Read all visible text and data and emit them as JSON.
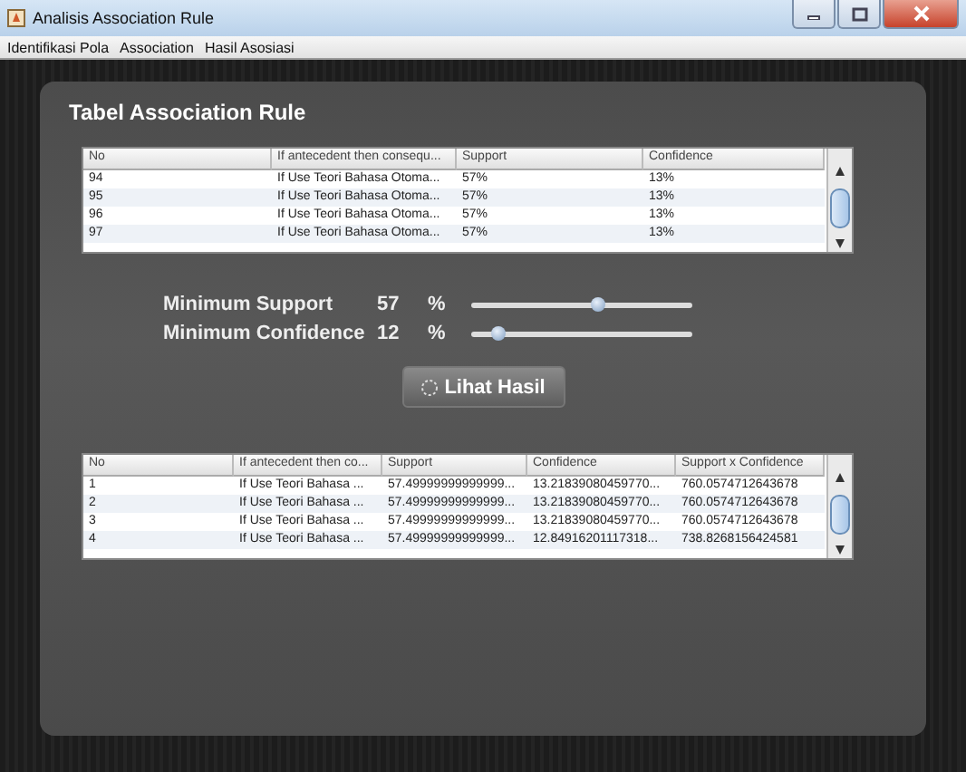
{
  "window": {
    "title": "Analisis Association Rule"
  },
  "menu": [
    {
      "label": "Identifikasi Pola"
    },
    {
      "label": "Association"
    },
    {
      "label": "Hasil Asosiasi"
    }
  ],
  "panel": {
    "title": "Tabel Association Rule"
  },
  "rules_table": {
    "columns": [
      "No",
      "If antecedent then consequ...",
      "Support",
      "Confidence"
    ],
    "rows": [
      [
        "94",
        "If Use Teori Bahasa Otoma...",
        "57%",
        "13%"
      ],
      [
        "95",
        "If Use Teori Bahasa Otoma...",
        "57%",
        "13%"
      ],
      [
        "96",
        "If Use Teori Bahasa Otoma...",
        "57%",
        "13%"
      ],
      [
        "97",
        "If Use Teori Bahasa Otoma...",
        "57%",
        "13%"
      ]
    ]
  },
  "sliders": [
    {
      "label": "Minimum Support",
      "value": "57",
      "unit": "%",
      "level": 0.57
    },
    {
      "label": "Minimum Confidence",
      "value": "12",
      "unit": "%",
      "level": 0.12
    }
  ],
  "button": {
    "label": "Lihat Hasil"
  },
  "result_table": {
    "columns": [
      "No",
      "If antecedent then co...",
      "Support",
      "Confidence",
      "Support x Confidence"
    ],
    "rows": [
      [
        "1",
        "If Use Teori Bahasa ...",
        "57.49999999999999...",
        "13.21839080459770...",
        "760.0574712643678"
      ],
      [
        "2",
        "If Use Teori Bahasa ...",
        "57.49999999999999...",
        "13.21839080459770...",
        "760.0574712643678"
      ],
      [
        "3",
        "If Use Teori Bahasa ...",
        "57.49999999999999...",
        "13.21839080459770...",
        "760.0574712643678"
      ],
      [
        "4",
        "If Use Teori Bahasa ...",
        "57.49999999999999...",
        "12.84916201117318...",
        "738.8268156424581"
      ]
    ]
  }
}
